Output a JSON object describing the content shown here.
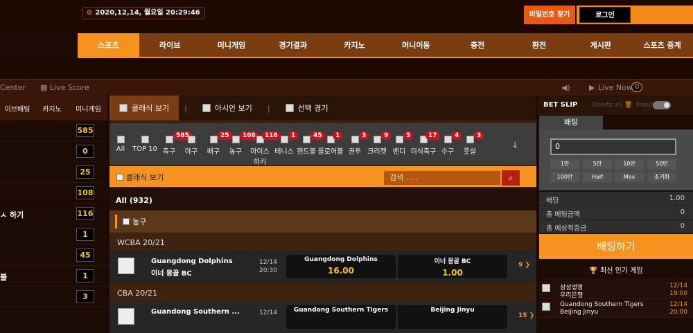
{
  "header": {
    "datetime": "2020,12,14, 월요일 20:29:46",
    "find_password": "비밀번호 찾기",
    "login": "로그인"
  },
  "nav": [
    "스포츠",
    "라이브",
    "미니게임",
    "경기결과",
    "카지노",
    "머니이동",
    "충전",
    "환전",
    "게시판",
    "스포츠 중계"
  ],
  "subbar": {
    "center": "Center",
    "live_score": "Live Score",
    "live_now": "Live Now",
    "live_count": "0"
  },
  "left": {
    "headers": [
      "이브배팅",
      "카지노",
      "미니게임"
    ],
    "rows": [
      {
        "label": "",
        "count": "585"
      },
      {
        "label": "",
        "count": "0"
      },
      {
        "label": "",
        "count": "25"
      },
      {
        "label": "",
        "count": "108"
      },
      {
        "label": "ㅅ 하기",
        "count": "116"
      },
      {
        "label": "",
        "count": "1"
      },
      {
        "label": "",
        "count": "45"
      },
      {
        "label": "볼",
        "count": "1"
      },
      {
        "label": "",
        "count": "3"
      }
    ]
  },
  "tabs": [
    "클래식 보기",
    "아시안 보기",
    "선택 경기"
  ],
  "sports": [
    {
      "name": "All",
      "count": ""
    },
    {
      "name": "TOP 10",
      "count": ""
    },
    {
      "name": "축구",
      "count": "585"
    },
    {
      "name": "야구",
      "count": ""
    },
    {
      "name": "배구",
      "count": "25"
    },
    {
      "name": "농구",
      "count": "108"
    },
    {
      "name": "아이스 하키",
      "count": "116"
    },
    {
      "name": "테니스",
      "count": "1"
    },
    {
      "name": "핸드볼",
      "count": "45"
    },
    {
      "name": "플로어볼",
      "count": "1"
    },
    {
      "name": "권투",
      "count": "3"
    },
    {
      "name": "크리켓",
      "count": "9"
    },
    {
      "name": "밴디",
      "count": "5"
    },
    {
      "name": "미식축구",
      "count": "17"
    },
    {
      "name": "수구",
      "count": "4"
    },
    {
      "name": "풋살",
      "count": "3"
    }
  ],
  "classic_label": "클래식 보기",
  "search_placeholder": "검색 . . .",
  "all_label": "All (932)",
  "category": "농구",
  "leagues": [
    {
      "name": "WCBA 20/21",
      "home": "Guangdong Dolphins",
      "away": "이너 몽골 BC",
      "date": "12/14",
      "time": "20:30",
      "odd1_name": "Guangdong Dolphins",
      "odd1": "16.00",
      "odd2_name": "이너 몽골 BC",
      "odd2": "1.00",
      "more": "9"
    },
    {
      "name": "CBA 20/21",
      "home": "Guandong Southern ...",
      "away": "",
      "date": "12/14",
      "time": "",
      "odd1_name": "Guandong Southern Tigers",
      "odd1": "",
      "odd2_name": "Beijing Jinyu",
      "odd2": "",
      "more": "15"
    }
  ],
  "betslip": {
    "title": "BET SLIP",
    "delete_all": "Delete all",
    "fixed": "Fixed",
    "tab": "배팅",
    "amount": "0",
    "quick": [
      "1만",
      "5만",
      "10만",
      "50만",
      "100만",
      "Half",
      "Max",
      "초기화"
    ],
    "odds_label": "배당",
    "odds_value": "1.00",
    "total_label": "총 베팅금액",
    "total_value": "0",
    "expected_label": "총 예상적중금",
    "expected_value": "0",
    "bet_button": "배팅하기"
  },
  "popular": {
    "title": "최신 인기 게임",
    "items": [
      {
        "a": "삼성생명",
        "b": "우리은행",
        "date": "12/14",
        "time": "19:00"
      },
      {
        "a": "Guandong Southern Tigers",
        "b": "Beijing Jinyu",
        "date": "12/14",
        "time": "20:00"
      }
    ]
  }
}
